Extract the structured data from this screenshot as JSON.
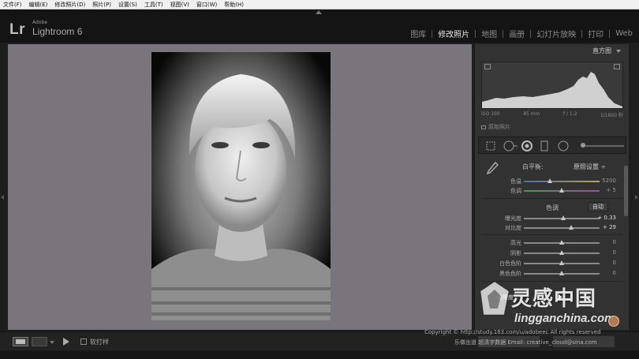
{
  "menu": [
    "文件(F)",
    "编辑(E)",
    "修改照片(D)",
    "照片(P)",
    "设置(S)",
    "工具(T)",
    "视图(V)",
    "窗口(W)",
    "帮助(H)"
  ],
  "brand": {
    "logo": "Lr",
    "small": "Adobe",
    "name": "Lightroom 6"
  },
  "modules": [
    {
      "label": "图库",
      "active": false
    },
    {
      "label": "修改照片",
      "active": true
    },
    {
      "label": "地图",
      "active": false
    },
    {
      "label": "画册",
      "active": false
    },
    {
      "label": "幻灯片放映",
      "active": false
    },
    {
      "label": "打印",
      "active": false
    },
    {
      "label": "Web",
      "active": false
    }
  ],
  "histogram": {
    "title": "直方图",
    "exif": [
      "ISO 100",
      "85 mm",
      "f / 1.2",
      "1/1600 秒"
    ],
    "original_photo_label": "原始照片"
  },
  "basic": {
    "wb_label": "白平衡:",
    "wb_value": "原照设置 ÷",
    "tone_label": "色调",
    "auto_label": "自动",
    "sliders": [
      {
        "label": "色温",
        "value": "5200",
        "knob_pct": 34,
        "highlight": false,
        "group": "wb"
      },
      {
        "label": "色调",
        "value": "+ 5",
        "knob_pct": 50,
        "highlight": false,
        "group": "wb"
      },
      {
        "label": "曝光度",
        "value": "+ 0.33",
        "knob_pct": 52,
        "highlight": true,
        "group": "tone"
      },
      {
        "label": "对比度",
        "value": "+ 29",
        "knob_pct": 62,
        "highlight": true,
        "group": "tone"
      },
      {
        "label": "高光",
        "value": "0",
        "knob_pct": 50,
        "highlight": false,
        "group": "tone2"
      },
      {
        "label": "阴影",
        "value": "0",
        "knob_pct": 50,
        "highlight": false,
        "group": "tone2"
      },
      {
        "label": "白色色阶",
        "value": "0",
        "knob_pct": 50,
        "highlight": false,
        "group": "tone2"
      },
      {
        "label": "黑色色阶",
        "value": "0",
        "knob_pct": 50,
        "highlight": false,
        "group": "tone2"
      }
    ],
    "presence_label": "清晰度"
  },
  "toolbar": {
    "soft_proof_label": "软打样"
  },
  "watermark": {
    "title": "灵感中国",
    "url": "lingganchina.com",
    "copyright": "Copyright © http://study.163.com/u/adobeec All rights reserved",
    "credit": "乐做出道 超清字数据 Email: creative_cloud@sina.com"
  },
  "colors": {
    "background": "#7a757c",
    "panel": "#323232",
    "accent": "#e8e8e8"
  }
}
